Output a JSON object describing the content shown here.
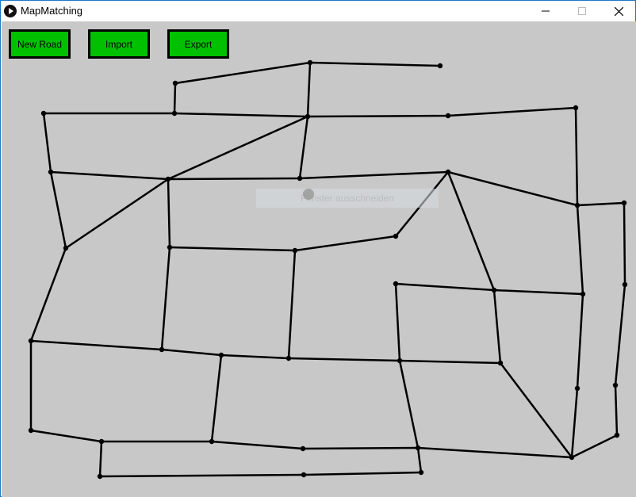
{
  "window": {
    "title": "MapMatching"
  },
  "toolbar": {
    "new_road_label": "New Road",
    "import_label": "Import",
    "export_label": "Export",
    "button_color": "#00c000"
  },
  "overlay": {
    "hint_text": "Fenster ausschneiden"
  },
  "icons": {
    "app": "play-circle-icon",
    "minimize": "minimize-icon",
    "maximize": "maximize-icon",
    "close": "close-icon"
  },
  "colors": {
    "canvas_background": "#c8c8c8",
    "road": "#000000"
  }
}
